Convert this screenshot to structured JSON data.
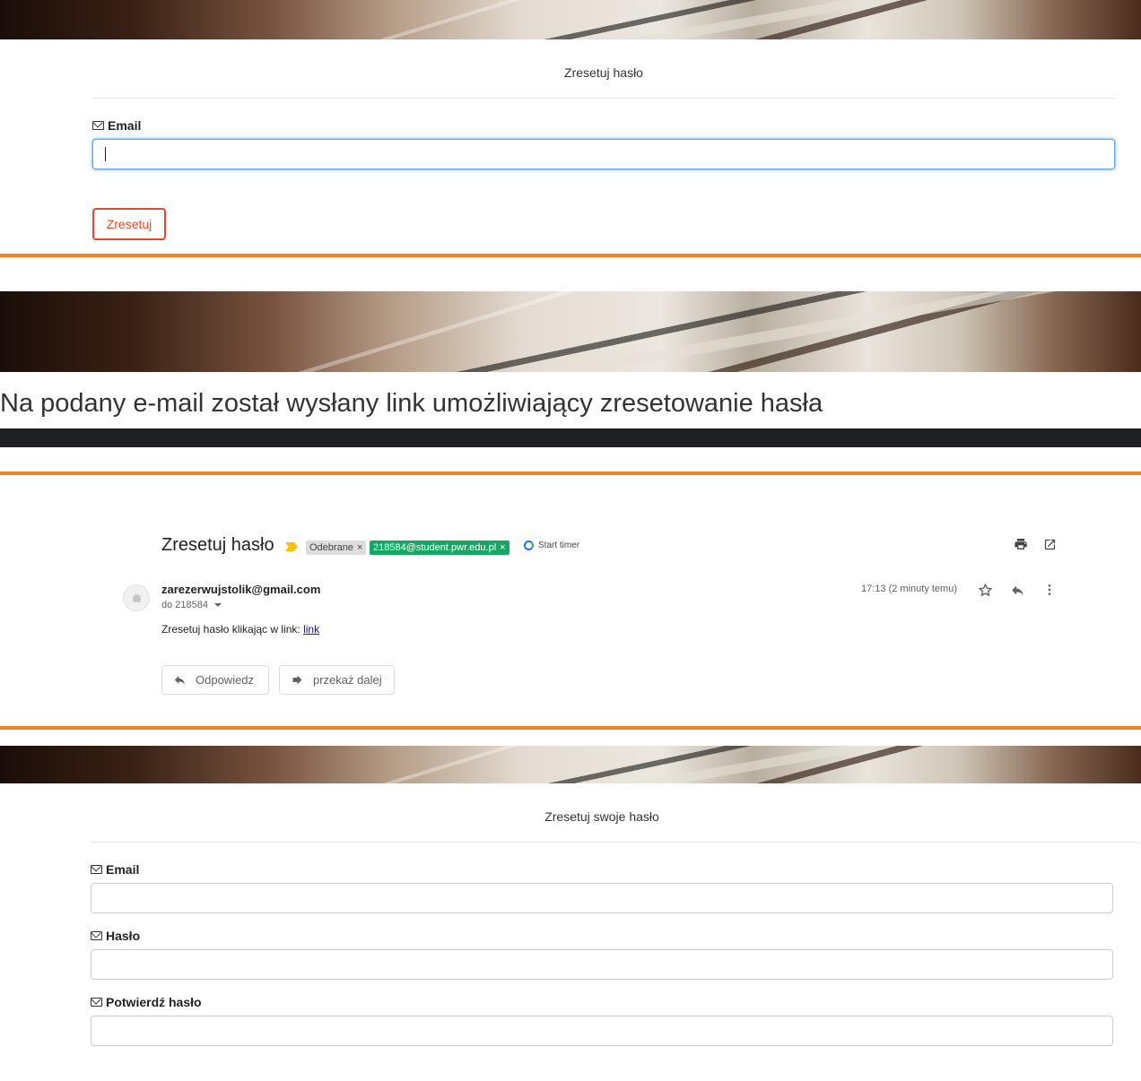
{
  "reset_form": {
    "title": "Zresetuj hasło",
    "email_label": "Email",
    "email_value": "",
    "submit_label": "Zresetuj"
  },
  "confirmation": {
    "message": "Na podany e-mail został wysłany link umożliwiający zresetowanie hasła"
  },
  "email_view": {
    "subject": "Zresetuj hasło",
    "labels": [
      {
        "text": "Odebrane",
        "remove": "×"
      },
      {
        "text": "218584@student.pwr.edu.pl",
        "remove": "×"
      }
    ],
    "timer_label": "Start timer",
    "sender": "zarezerwujstolik@gmail.com",
    "to_prefix": "do",
    "to": "218584",
    "time": "17:13 (2 minuty temu)",
    "body_text": "Zresetuj hasło klikając w link: ",
    "body_link": "link",
    "reply_label": "Odpowiedz",
    "forward_label": "przekaż dalej",
    "icons": [
      "print-icon",
      "open-in-new-window-icon",
      "star-icon",
      "reply-icon",
      "more-vert-icon"
    ]
  },
  "new_password_form": {
    "title": "Zresetuj swoje hasło",
    "email_label": "Email",
    "password_label": "Hasło",
    "confirm_label": "Potwierdź hasło"
  },
  "colors": {
    "accent_orange": "#f58220",
    "reset_red": "#e04a2f",
    "tag_green": "#16a765",
    "dark_bar": "#1f2023"
  }
}
